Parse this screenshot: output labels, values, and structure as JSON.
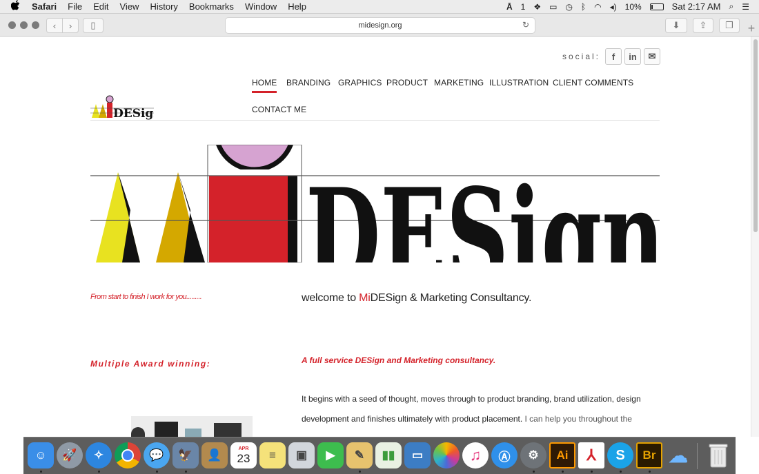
{
  "menubar": {
    "apple": "",
    "app": "Safari",
    "items": [
      "File",
      "Edit",
      "View",
      "History",
      "Bookmarks",
      "Window",
      "Help"
    ],
    "battery": "10%",
    "clock": "Sat 2:17 AM",
    "notif_count": "1"
  },
  "toolbar": {
    "url": "midesign.org"
  },
  "site": {
    "social_label": "social:",
    "social": [
      "f",
      "in",
      "✉"
    ],
    "logo_text": "DESign",
    "nav": [
      "HOME",
      "BRANDING",
      "GRAPHICS",
      "PRODUCT",
      "MARKETING",
      "ILLUSTRATION",
      "CLIENT COMMENTS"
    ],
    "nav2": "CONTACT ME",
    "hero_text": "DESign",
    "tagline": "From start to finish I work for you.........",
    "welcome_pre": "welcome to ",
    "welcome_mi": "Mi",
    "welcome_post": "DESign & Marketing Consultancy.",
    "award": "Multiple Award winning:",
    "subhead": "A full service DESign and Marketing consultancy.",
    "para1": "It begins with a seed of thought, moves through to  product branding, brand utilization, design",
    "para2a": "development and finishes ultimately with product placement. ",
    "para2b": "I can help you throughout the"
  },
  "dock": {
    "calendar_month": "APR",
    "calendar_day": "23",
    "apps": [
      "Finder",
      "Launchpad",
      "Safari",
      "Chrome",
      "Messages",
      "Preview",
      "Contacts",
      "Calendar",
      "Notes",
      "Photo Booth",
      "FaceTime",
      "Pages",
      "Numbers",
      "Keynote",
      "Photos",
      "iTunes",
      "App Store",
      "System Preferences",
      "Illustrator",
      "Acrobat",
      "Skype",
      "Bridge",
      "iCloud",
      "Trash"
    ],
    "ai_label": "Ai",
    "br_label": "Br",
    "skype_label": "S"
  },
  "colors": {
    "accent_red": "#d4222a",
    "logo_yellow": "#e8e220",
    "logo_gold": "#d4a800",
    "logo_pink": "#d6a3d1"
  }
}
